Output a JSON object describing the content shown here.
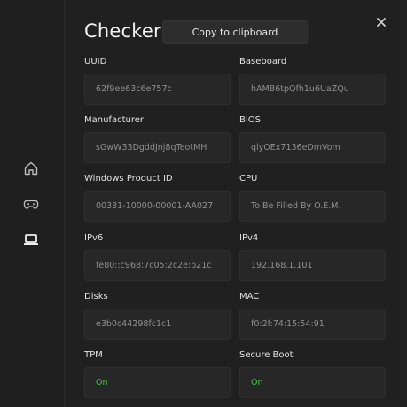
{
  "sidebar": {
    "items": [
      {
        "icon": "home-icon"
      },
      {
        "icon": "gamepad-icon"
      },
      {
        "icon": "laptop-icon"
      }
    ]
  },
  "header": {
    "title": "Checker",
    "copy_label": "Copy to clipboard",
    "close_icon": "close-icon"
  },
  "fields": {
    "uuid": {
      "label": "UUID",
      "value": "62f9ee63c6e757c"
    },
    "baseboard": {
      "label": "Baseboard",
      "value": "hAMB6tpQfh1u6UaZQu"
    },
    "manufacturer": {
      "label": "Manufacturer",
      "value": "sGwW33DgddJnj8qTeotMH"
    },
    "bios": {
      "label": "BIOS",
      "value": "qlyOEx7136eDmVom"
    },
    "product_id": {
      "label": "Windows Product ID",
      "value": "00331-10000-00001-AA027"
    },
    "cpu": {
      "label": "CPU",
      "value": "To Be Filled By O.E.M."
    },
    "ipv6": {
      "label": "IPv6",
      "value": "fe80::c968:7c05:2c2e:b21c"
    },
    "ipv4": {
      "label": "IPv4",
      "value": "192.168.1.101"
    },
    "disks": {
      "label": "Disks",
      "value": "e3b0c44298fc1c1"
    },
    "mac": {
      "label": "MAC",
      "value": "f0:2f:74:15:54:91"
    },
    "tpm": {
      "label": "TPM",
      "value": "On"
    },
    "secure_boot": {
      "label": "Secure Boot",
      "value": "On"
    }
  },
  "colors": {
    "status_ok": "#4cc24c",
    "background": "#202020"
  }
}
